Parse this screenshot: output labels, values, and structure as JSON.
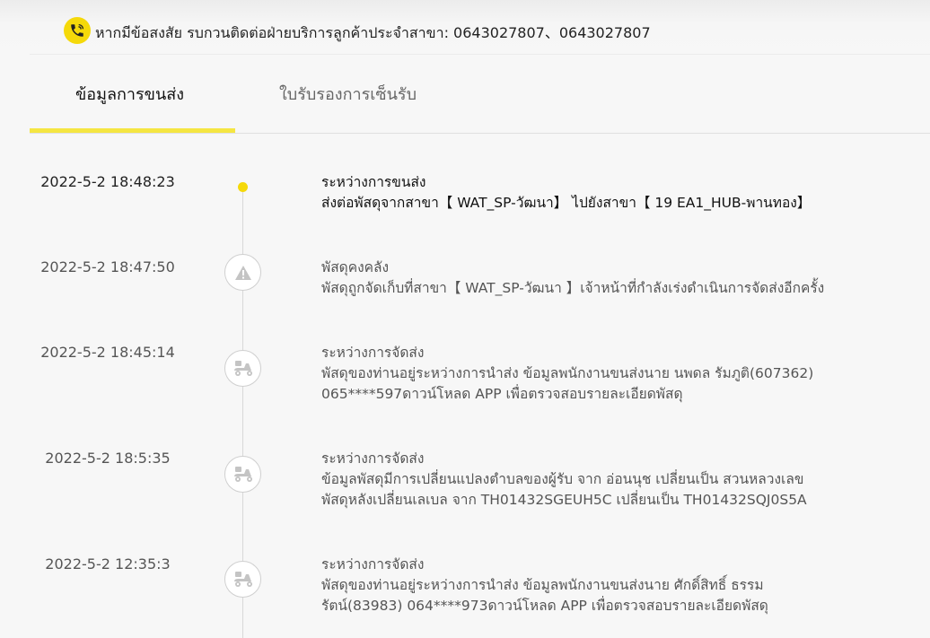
{
  "header": {
    "notice": "หากมีข้อสงสัย รบกวนติดต่อฝ่ายบริการลูกค้าประจำสาขา: 0643027807、0643027807",
    "icon": "phone-icon"
  },
  "tabs": [
    {
      "label": "ข้อมูลการขนส่ง",
      "active": true
    },
    {
      "label": "ใบรับรองการเซ็นรับ",
      "active": false
    }
  ],
  "colors": {
    "accent": "#f5d90a",
    "underline": "#f5e642",
    "marker_border": "#cfcfcf"
  },
  "events": [
    {
      "time": "2022-5-2 18:48:23",
      "status": "ระหว่างการขนส่ง",
      "lines": [
        "ส่งต่อพัสดุจากสาขา【 WAT_SP-วัฒนา】 ไปยังสาขา【 19 EA1_HUB-พานทอง】"
      ],
      "icon": "current-dot"
    },
    {
      "time": "2022-5-2 18:47:50",
      "status": "พัสดุคงคลัง",
      "lines": [
        "พัสดุถูกจัดเก็บที่สาขา【 WAT_SP-วัฒนา 】เจ้าหน้าที่กำลังเร่งดำเนินการจัดส่งอีกครั้ง"
      ],
      "icon": "warning-icon"
    },
    {
      "time": "2022-5-2 18:45:14",
      "status": "ระหว่างการจัดส่ง",
      "lines": [
        "พัสดุของท่านอยู่ระหว่างการนำส่ง ข้อมูลพนักงานขนส่งนาย นพดล รัมภูติ(607362)",
        "065****597ดาวน์โหลด APP เพื่อตรวจสอบรายละเอียดพัสดุ"
      ],
      "icon": "scooter-icon"
    },
    {
      "time": "2022-5-2 18:5:35",
      "status": "ระหว่างการจัดส่ง",
      "lines": [
        "ข้อมูลพัสดุมีการเปลี่ยนแปลงตำบลของผู้รับ จาก อ่อนนุช เปลี่ยนเป็น สวนหลวงเลข",
        "พัสดุหลังเปลี่ยนเลเบล จาก TH01432SGEUH5C เปลี่ยนเป็น TH01432SQJ0S5A"
      ],
      "icon": "scooter-icon"
    },
    {
      "time": "2022-5-2 12:35:3",
      "status": "ระหว่างการจัดส่ง",
      "lines": [
        "พัสดุของท่านอยู่ระหว่างการนำส่ง ข้อมูลพนักงานขนส่งนาย ศักดิ์สิทธิ์ ธรรม",
        "รัตน์(83983) 064****973ดาวน์โหลด APP เพื่อตรวจสอบรายละเอียดพัสดุ"
      ],
      "icon": "scooter-icon"
    }
  ]
}
